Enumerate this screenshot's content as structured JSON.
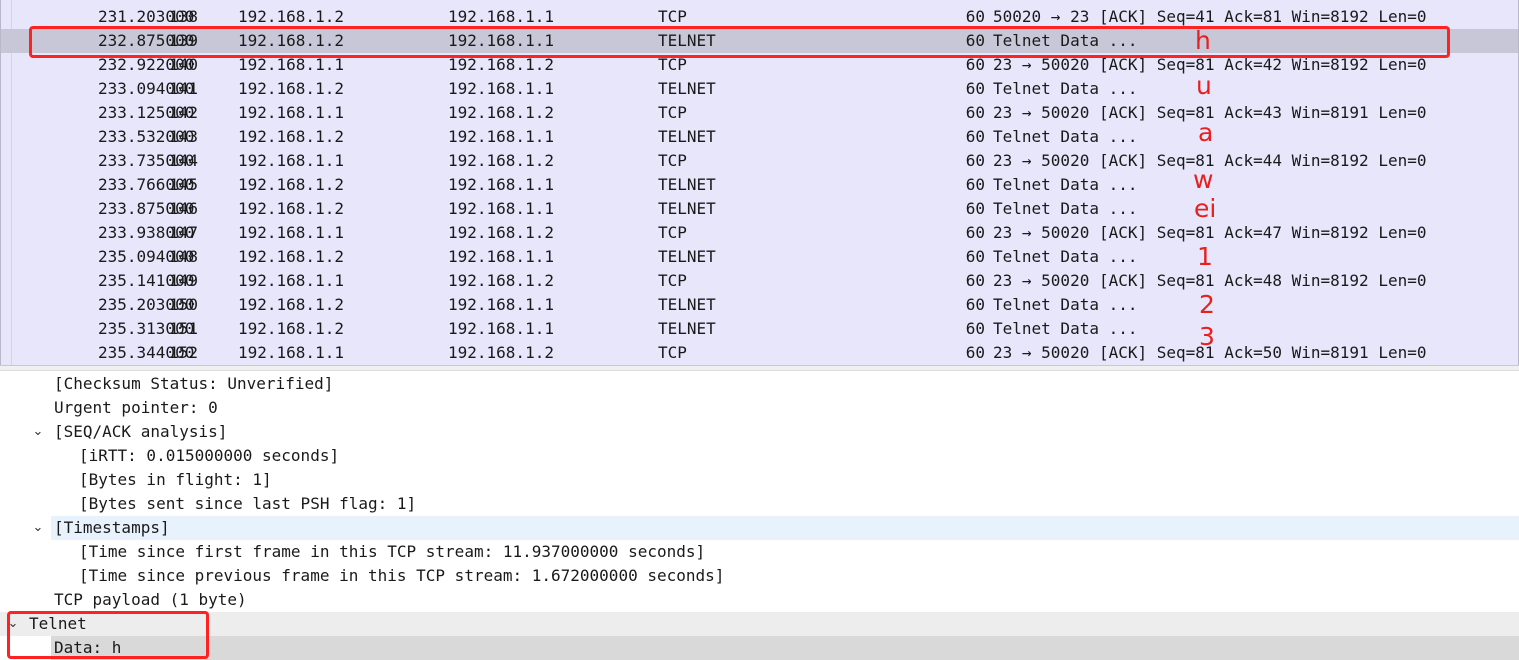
{
  "packets": [
    {
      "no": "138",
      "time": "231.203000",
      "src": "192.168.1.2",
      "dst": "192.168.1.1",
      "proto": "TCP",
      "len": "60",
      "info": "50020 → 23 [ACK] Seq=41 Ack=81 Win=8192 Len=0"
    },
    {
      "no": "139",
      "time": "232.875000",
      "src": "192.168.1.2",
      "dst": "192.168.1.1",
      "proto": "TELNET",
      "len": "60",
      "info": "Telnet Data ..."
    },
    {
      "no": "140",
      "time": "232.922000",
      "src": "192.168.1.1",
      "dst": "192.168.1.2",
      "proto": "TCP",
      "len": "60",
      "info": "23 → 50020 [ACK] Seq=81 Ack=42 Win=8192 Len=0"
    },
    {
      "no": "141",
      "time": "233.094000",
      "src": "192.168.1.2",
      "dst": "192.168.1.1",
      "proto": "TELNET",
      "len": "60",
      "info": "Telnet Data ..."
    },
    {
      "no": "142",
      "time": "233.125000",
      "src": "192.168.1.1",
      "dst": "192.168.1.2",
      "proto": "TCP",
      "len": "60",
      "info": "23 → 50020 [ACK] Seq=81 Ack=43 Win=8191 Len=0"
    },
    {
      "no": "143",
      "time": "233.532000",
      "src": "192.168.1.2",
      "dst": "192.168.1.1",
      "proto": "TELNET",
      "len": "60",
      "info": "Telnet Data ..."
    },
    {
      "no": "144",
      "time": "233.735000",
      "src": "192.168.1.1",
      "dst": "192.168.1.2",
      "proto": "TCP",
      "len": "60",
      "info": "23 → 50020 [ACK] Seq=81 Ack=44 Win=8192 Len=0"
    },
    {
      "no": "145",
      "time": "233.766000",
      "src": "192.168.1.2",
      "dst": "192.168.1.1",
      "proto": "TELNET",
      "len": "60",
      "info": "Telnet Data ..."
    },
    {
      "no": "146",
      "time": "233.875000",
      "src": "192.168.1.2",
      "dst": "192.168.1.1",
      "proto": "TELNET",
      "len": "60",
      "info": "Telnet Data ..."
    },
    {
      "no": "147",
      "time": "233.938000",
      "src": "192.168.1.1",
      "dst": "192.168.1.2",
      "proto": "TCP",
      "len": "60",
      "info": "23 → 50020 [ACK] Seq=81 Ack=47 Win=8192 Len=0"
    },
    {
      "no": "148",
      "time": "235.094000",
      "src": "192.168.1.2",
      "dst": "192.168.1.1",
      "proto": "TELNET",
      "len": "60",
      "info": "Telnet Data ..."
    },
    {
      "no": "149",
      "time": "235.141000",
      "src": "192.168.1.1",
      "dst": "192.168.1.2",
      "proto": "TCP",
      "len": "60",
      "info": "23 → 50020 [ACK] Seq=81 Ack=48 Win=8192 Len=0"
    },
    {
      "no": "150",
      "time": "235.203000",
      "src": "192.168.1.2",
      "dst": "192.168.1.1",
      "proto": "TELNET",
      "len": "60",
      "info": "Telnet Data ..."
    },
    {
      "no": "151",
      "time": "235.313000",
      "src": "192.168.1.2",
      "dst": "192.168.1.1",
      "proto": "TELNET",
      "len": "60",
      "info": "Telnet Data ..."
    },
    {
      "no": "152",
      "time": "235.344000",
      "src": "192.168.1.1",
      "dst": "192.168.1.2",
      "proto": "TCP",
      "len": "60",
      "info": "23 → 50020 [ACK] Seq=81 Ack=50 Win=8191 Len=0"
    }
  ],
  "selected_packet": "139",
  "details": [
    {
      "text": "[Checksum Status: Unverified]"
    },
    {
      "text": "Urgent pointer: 0"
    },
    {
      "text": "[SEQ/ACK analysis]",
      "expanded": true
    },
    {
      "text": "[iRTT: 0.015000000 seconds]"
    },
    {
      "text": "[Bytes in flight: 1]"
    },
    {
      "text": "[Bytes sent since last PSH flag: 1]"
    },
    {
      "text": "[Timestamps]",
      "expanded": true
    },
    {
      "text": "[Time since first frame in this TCP stream: 11.937000000 seconds]"
    },
    {
      "text": "[Time since previous frame in this TCP stream: 1.672000000 seconds]"
    },
    {
      "text": "TCP payload (1 byte)"
    },
    {
      "text": "Telnet",
      "expanded": true
    },
    {
      "text": "Data: h"
    }
  ],
  "annotations": [
    "h",
    "u",
    "a",
    "w",
    "ei",
    "1",
    "2",
    "3"
  ],
  "colors": {
    "list_background": "#e7e6fa",
    "selected_row": "#c8c7d7",
    "annotation_red": "#ff2222"
  }
}
